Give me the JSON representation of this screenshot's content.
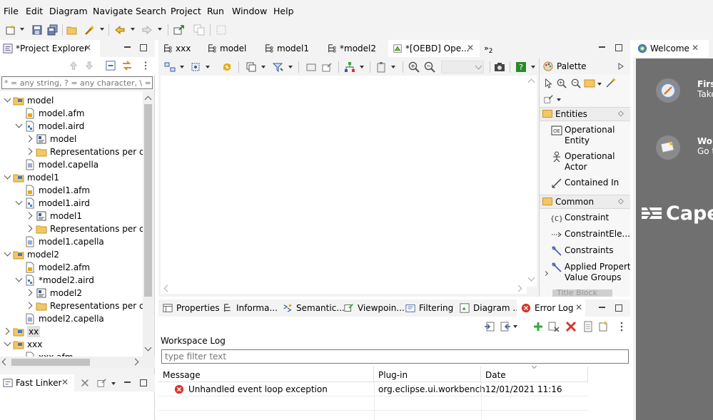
{
  "menu": [
    "File",
    "Edit",
    "Diagram",
    "Navigate",
    "Search",
    "Project",
    "Run",
    "Window",
    "Help"
  ],
  "project_explorer": {
    "title": "*Project Explorer",
    "filter_placeholder": "* = any string, ? = any character, \\ = esc",
    "tree": [
      {
        "label": "model",
        "depth": 0,
        "kind": "project",
        "expanded": true
      },
      {
        "label": "model.afm",
        "depth": 1,
        "kind": "afm"
      },
      {
        "label": "model.aird",
        "depth": 1,
        "kind": "aird",
        "expanded": true
      },
      {
        "label": "model",
        "depth": 2,
        "kind": "model",
        "collapsed": true
      },
      {
        "label": "Representations per cate",
        "depth": 2,
        "kind": "folder",
        "collapsed": true
      },
      {
        "label": "model.capella",
        "depth": 1,
        "kind": "capella"
      },
      {
        "label": "model1",
        "depth": 0,
        "kind": "project",
        "expanded": true
      },
      {
        "label": "model1.afm",
        "depth": 1,
        "kind": "afm"
      },
      {
        "label": "model1.aird",
        "depth": 1,
        "kind": "aird",
        "expanded": true
      },
      {
        "label": "model1",
        "depth": 2,
        "kind": "model",
        "collapsed": true
      },
      {
        "label": "Representations per cate",
        "depth": 2,
        "kind": "folder",
        "collapsed": true
      },
      {
        "label": "model1.capella",
        "depth": 1,
        "kind": "capella"
      },
      {
        "label": "model2",
        "depth": 0,
        "kind": "project",
        "expanded": true
      },
      {
        "label": "model2.afm",
        "depth": 1,
        "kind": "afm"
      },
      {
        "label": "*model2.aird",
        "depth": 1,
        "kind": "aird",
        "expanded": true
      },
      {
        "label": "model2",
        "depth": 2,
        "kind": "model",
        "collapsed": true
      },
      {
        "label": "Representations per cate",
        "depth": 2,
        "kind": "folder",
        "collapsed": true
      },
      {
        "label": "model2.capella",
        "depth": 1,
        "kind": "capella"
      },
      {
        "label": "xx",
        "depth": 0,
        "kind": "project",
        "collapsed": true,
        "selected": true
      },
      {
        "label": "xxx",
        "depth": 0,
        "kind": "project",
        "expanded": true
      },
      {
        "label": "xxx.afm",
        "depth": 1,
        "kind": "afm"
      }
    ]
  },
  "fast_linker": {
    "title": "Fast Linker"
  },
  "editor_tabs": [
    {
      "label": "xxx"
    },
    {
      "label": "model"
    },
    {
      "label": "model1"
    },
    {
      "label": "*model2"
    },
    {
      "label": "*[OEBD] Ope...",
      "active": true
    }
  ],
  "editor_overflow": "2",
  "palette": {
    "title": "Palette",
    "entities_title": "Entities",
    "entities": [
      {
        "line1": "Operational",
        "line2": "Entity"
      },
      {
        "line1": "Operational",
        "line2": "Actor"
      },
      {
        "line1": "Contained In",
        "line2": ""
      }
    ],
    "common_title": "Common",
    "common": [
      {
        "line1": "Constraint",
        "line2": ""
      },
      {
        "line1": "ConstraintEle...",
        "line2": ""
      },
      {
        "line1": "Constraints",
        "line2": ""
      },
      {
        "line1": "Applied Property",
        "line2": "Value Groups"
      }
    ],
    "cut_item": "Title Block"
  },
  "bottom_tabs": [
    {
      "label": "Properties"
    },
    {
      "label": "Informa..."
    },
    {
      "label": "Semantic..."
    },
    {
      "label": "Viewpoin..."
    },
    {
      "label": "Filtering"
    },
    {
      "label": "Diagram ..."
    },
    {
      "label": "Error Log",
      "active": true
    }
  ],
  "error_log": {
    "workspace_label": "Workspace Log",
    "filter_placeholder": "type filter text",
    "columns": [
      "Message",
      "Plug-in",
      "Date"
    ],
    "rows": [
      {
        "message": "Unhandled event loop exception",
        "plugin": "org.eclipse.ui.workbench",
        "date": "12/01/2021 11:16"
      }
    ]
  },
  "welcome": {
    "title": "Welcome",
    "item1_title": "Firs",
    "item1_sub": "Take",
    "item2_title": "Wor",
    "item2_sub": "Go t",
    "brand": "Cape"
  },
  "colors": {
    "chrome": "#f3f3f3",
    "welcome_bg": "#707070",
    "selection": "#e0e0e0",
    "error_red": "#d9342b",
    "folder": "#f3c766",
    "add_green": "#3aa63a"
  }
}
